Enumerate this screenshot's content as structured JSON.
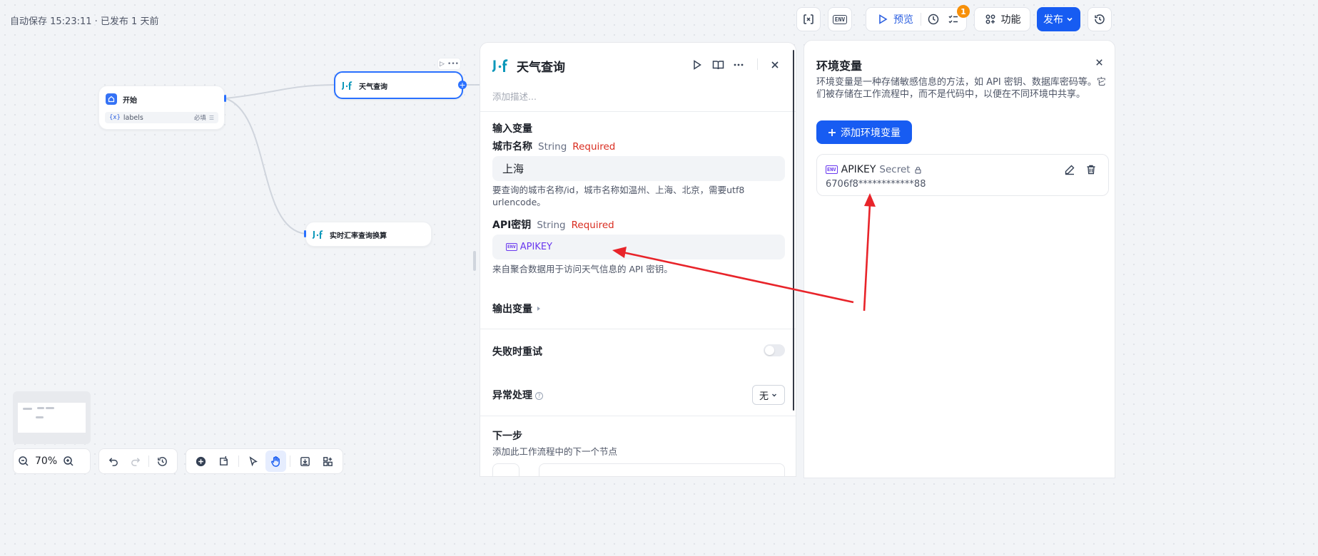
{
  "header": {
    "status": "自动保存 15:23:11 · 已发布 1 天前"
  },
  "toolbar": {
    "preview_label": "预览",
    "checklist_badge": "1",
    "features_label": "功能",
    "publish_label": "发布",
    "env_icon_text": "ENV"
  },
  "nodes": {
    "start": {
      "title": "开始",
      "var_icon": "{x}",
      "var_name": "labels",
      "var_required": "必填"
    },
    "weather": {
      "title": "天气查询"
    },
    "exchange": {
      "title": "实时汇率查询换算"
    }
  },
  "zoom": {
    "level": "70%"
  },
  "panel": {
    "title": "天气查询",
    "description_placeholder": "添加描述...",
    "input_section": "输入变量",
    "fields": [
      {
        "label": "城市名称",
        "type": "String",
        "required": "Required",
        "value": "上海",
        "help": "要查询的城市名称/id，城市名称如温州、上海、北京，需要utf8 urlencode。"
      },
      {
        "label": "API密钥",
        "type": "String",
        "required": "Required",
        "env_tag": "ENV",
        "value": "APIKEY",
        "help": "来自聚合数据用于访问天气信息的 API 密钥。"
      }
    ],
    "output_section": "输出变量",
    "retry_label": "失败时重试",
    "retry_enabled": false,
    "error_label": "异常处理",
    "error_value": "无",
    "next_title": "下一步",
    "next_desc": "添加此工作流程中的下一个节点"
  },
  "env_panel": {
    "title": "环境变量",
    "description": "环境变量是一种存储敏感信息的方法，如 API 密钥、数据库密码等。它们被存储在工作流程中，而不是代码中，以便在不同环境中共享。",
    "add_label": "添加环境变量",
    "variables": [
      {
        "tag": "ENV",
        "name": "APIKEY",
        "kind": "Secret",
        "value": "6706f8************88"
      }
    ]
  },
  "colors": {
    "primary": "#175cf2",
    "required": "#d92d20",
    "env": "#6938ef",
    "annotation": "#e8242a"
  }
}
